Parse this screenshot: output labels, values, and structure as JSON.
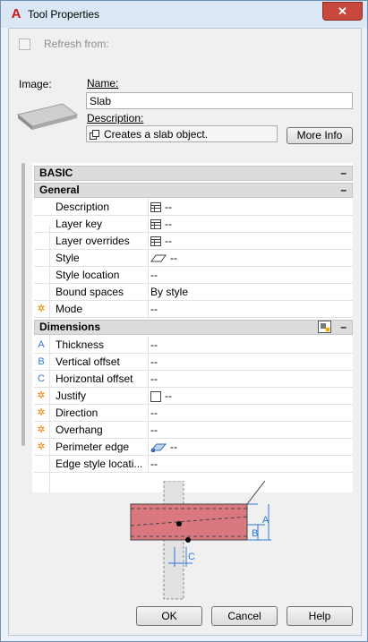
{
  "window": {
    "title": "Tool Properties",
    "close_symbol": "✕",
    "app_icon_glyph": "A"
  },
  "top": {
    "refresh_label": "Refresh from:",
    "refresh_checked": false
  },
  "image_label": "Image:",
  "name": {
    "label": "Name:",
    "value": "Slab"
  },
  "description": {
    "label": "Description:",
    "value": "Creates a slab object.",
    "more_info": "More Info"
  },
  "categories": {
    "basic": {
      "label": "BASIC",
      "toggle": "–"
    },
    "general": {
      "label": "General",
      "toggle": "–"
    },
    "dimensions": {
      "label": "Dimensions",
      "toggle": "–"
    }
  },
  "general_rows": [
    {
      "name": "Description",
      "value": "--",
      "icon": "table-icon",
      "marker": ""
    },
    {
      "name": "Layer key",
      "value": "--",
      "icon": "table-icon",
      "marker": ""
    },
    {
      "name": "Layer overrides",
      "value": "--",
      "icon": "table-icon",
      "marker": ""
    },
    {
      "name": "Style",
      "value": "--",
      "icon": "slab-style-icon",
      "marker": ""
    },
    {
      "name": "Style location",
      "value": "--",
      "icon": "",
      "marker": ""
    },
    {
      "name": "Bound spaces",
      "value": "By style",
      "icon": "",
      "marker": ""
    },
    {
      "name": "Mode",
      "value": "--",
      "icon": "",
      "marker": "*"
    }
  ],
  "dimension_rows": [
    {
      "name": "Thickness",
      "value": "--",
      "icon": "",
      "marker": "A"
    },
    {
      "name": "Vertical offset",
      "value": "--",
      "icon": "",
      "marker": "B"
    },
    {
      "name": "Horizontal offset",
      "value": "--",
      "icon": "",
      "marker": "C"
    },
    {
      "name": "Justify",
      "value": "--",
      "icon": "justify-icon",
      "marker": "*"
    },
    {
      "name": "Direction",
      "value": "--",
      "icon": "",
      "marker": "*"
    },
    {
      "name": "Overhang",
      "value": "--",
      "icon": "",
      "marker": "*"
    },
    {
      "name": "Perimeter edge",
      "value": "--",
      "icon": "edge-icon",
      "marker": "*"
    },
    {
      "name": "Edge style locati...",
      "value": "--",
      "icon": "",
      "marker": ""
    }
  ],
  "diagram": {
    "labels": [
      "A",
      "B",
      "C"
    ]
  },
  "buttons": {
    "ok": "OK",
    "cancel": "Cancel",
    "help": "Help"
  },
  "colors": {
    "slab_fill": "#d9787f",
    "accent_blue": "#2f78d6",
    "marker_orange": "#f08000"
  }
}
